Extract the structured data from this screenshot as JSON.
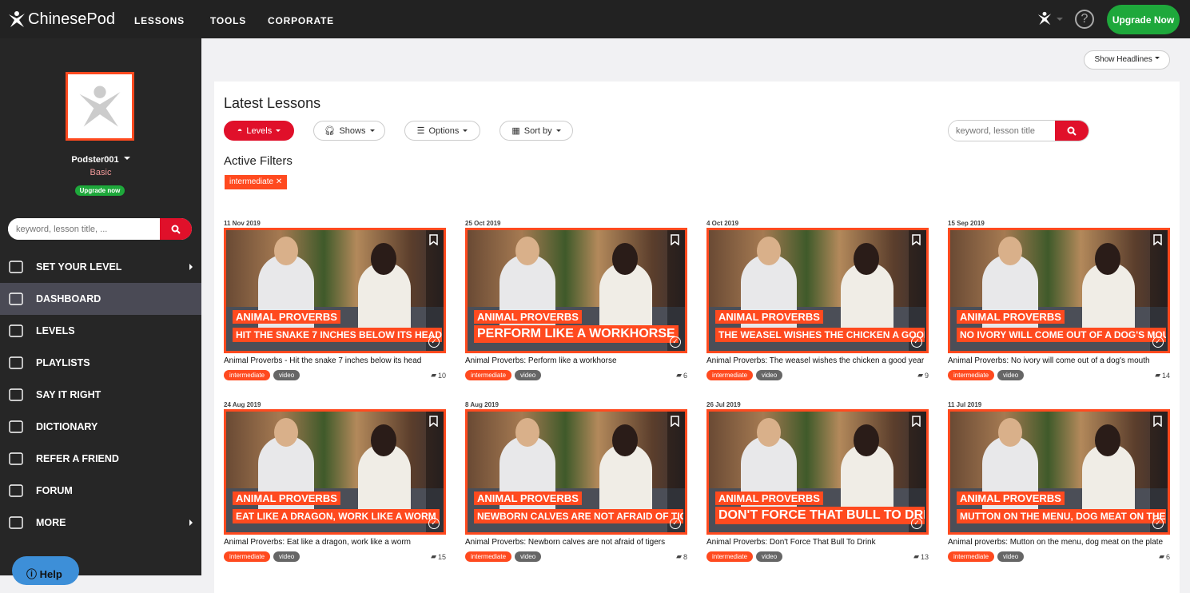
{
  "header": {
    "brand": "ChinesePod",
    "nav": [
      "LESSONS",
      "TOOLS",
      "CORPORATE"
    ],
    "upgrade": "Upgrade Now",
    "help_icon": "question-circle-icon"
  },
  "sidebar": {
    "username": "Podster001",
    "plan": "Basic",
    "upgrade": "Upgrade now",
    "search_placeholder": "keyword, lesson title, ...",
    "items": [
      {
        "label": "SET YOUR LEVEL",
        "icon": "level-bars-icon",
        "arrow": true
      },
      {
        "label": "DASHBOARD",
        "icon": "temple-icon",
        "active": true
      },
      {
        "label": "LEVELS",
        "icon": "levels-icon"
      },
      {
        "label": "PLAYLISTS",
        "icon": "books-icon"
      },
      {
        "label": "SAY IT RIGHT",
        "icon": "speech-icon"
      },
      {
        "label": "DICTIONARY",
        "icon": "book-icon"
      },
      {
        "label": "REFER A FRIEND",
        "icon": "add-user-icon"
      },
      {
        "label": "FORUM",
        "icon": "chat-icon"
      },
      {
        "label": "MORE",
        "icon": "more-icon",
        "arrow": true
      }
    ],
    "help": "Help"
  },
  "main": {
    "show_headlines": "Show Headlines",
    "title": "Latest Lessons",
    "filters": [
      "Levels",
      "Shows",
      "Options",
      "Sort by"
    ],
    "search_placeholder": "keyword, lesson title",
    "active_filters_title": "Active Filters",
    "active_filter": "intermediate",
    "accent": "#ff4a1f",
    "red": "#e0102a",
    "green": "#1ea83b",
    "lessons": [
      {
        "date": "11 Nov 2019",
        "show": "ANIMAL PROVERBS",
        "overlay": "HIT THE SNAKE 7 INCHES BELOW ITS HEAD",
        "title": "Animal Proverbs - Hit the snake 7 inches below its head",
        "level": "intermediate",
        "type": "video",
        "comments": "10"
      },
      {
        "date": "25 Oct 2019",
        "show": "ANIMAL PROVERBS",
        "overlay": "PERFORM LIKE A WORKHORSE",
        "title": "Animal Proverbs: Perform like a workhorse",
        "level": "intermediate",
        "type": "video",
        "comments": "6"
      },
      {
        "date": "4 Oct 2019",
        "show": "ANIMAL PROVERBS",
        "overlay": "THE WEASEL WISHES THE CHICKEN A GOOD YEAR",
        "title": "Animal Proverbs: The weasel wishes the chicken a good year",
        "level": "intermediate",
        "type": "video",
        "comments": "9"
      },
      {
        "date": "15 Sep 2019",
        "show": "ANIMAL PROVERBS",
        "overlay": "NO IVORY WILL COME OUT OF A DOG'S MOUTH",
        "title": "Animal Proverbs: No ivory will come out of a dog's mouth",
        "level": "intermediate",
        "type": "video",
        "comments": "14"
      },
      {
        "date": "24 Aug 2019",
        "show": "ANIMAL PROVERBS",
        "overlay": "EAT LIKE A DRAGON, WORK LIKE A WORM",
        "title": "Animal Proverbs: Eat like a dragon, work like a worm",
        "level": "intermediate",
        "type": "video",
        "comments": "15"
      },
      {
        "date": "8 Aug 2019",
        "show": "ANIMAL PROVERBS",
        "overlay": "NEWBORN CALVES ARE NOT AFRAID OF TIGERS",
        "title": "Animal Proverbs: Newborn calves are not afraid of tigers",
        "level": "intermediate",
        "type": "video",
        "comments": "8"
      },
      {
        "date": "26 Jul 2019",
        "show": "ANIMAL PROVERBS",
        "overlay": "DON'T FORCE THAT BULL TO DRINK",
        "title": "Animal Proverbs: Don't Force That Bull To Drink",
        "level": "intermediate",
        "type": "video",
        "comments": "13"
      },
      {
        "date": "11 Jul 2019",
        "show": "ANIMAL PROVERBS",
        "overlay": "MUTTON ON THE MENU, DOG MEAT ON THE PLATE",
        "title": "Animal proverbs: Mutton on the menu, dog meat on the plate",
        "level": "intermediate",
        "type": "video",
        "comments": "6"
      }
    ]
  }
}
